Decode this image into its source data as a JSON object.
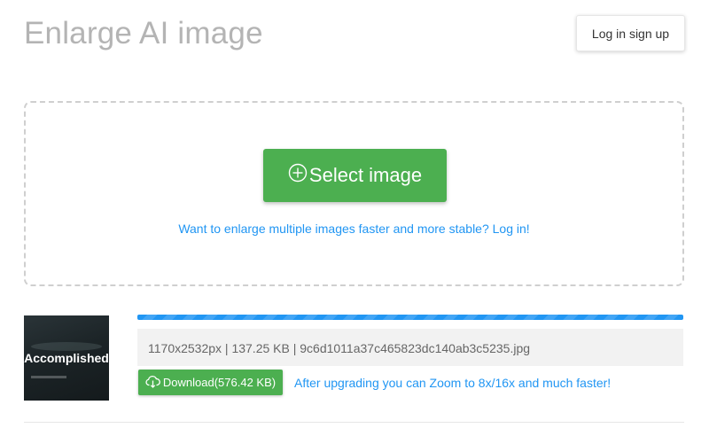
{
  "header": {
    "title": "Enlarge AI image",
    "auth_label": "Log in sign up"
  },
  "upload": {
    "select_label": "Select image",
    "select_icon": "plus-circle-icon",
    "login_hint": "Want to enlarge multiple images faster and more stable? Log in!"
  },
  "result": {
    "thumbnail_caption": "Accomplished",
    "progress": 1.0,
    "file_info": "1170x2532px | 137.25 KB | 9c6d1011a37c465823dc140ab3c5235.jpg",
    "download_label": "Download(576.42 KB)",
    "download_icon": "cloud-download-icon",
    "upgrade_hint": "After upgrading you can Zoom to 8x/16x and much faster!"
  },
  "colors": {
    "accent_green": "#4caf50",
    "link_blue": "#2196f3",
    "title_gray": "#b4b4b4"
  }
}
